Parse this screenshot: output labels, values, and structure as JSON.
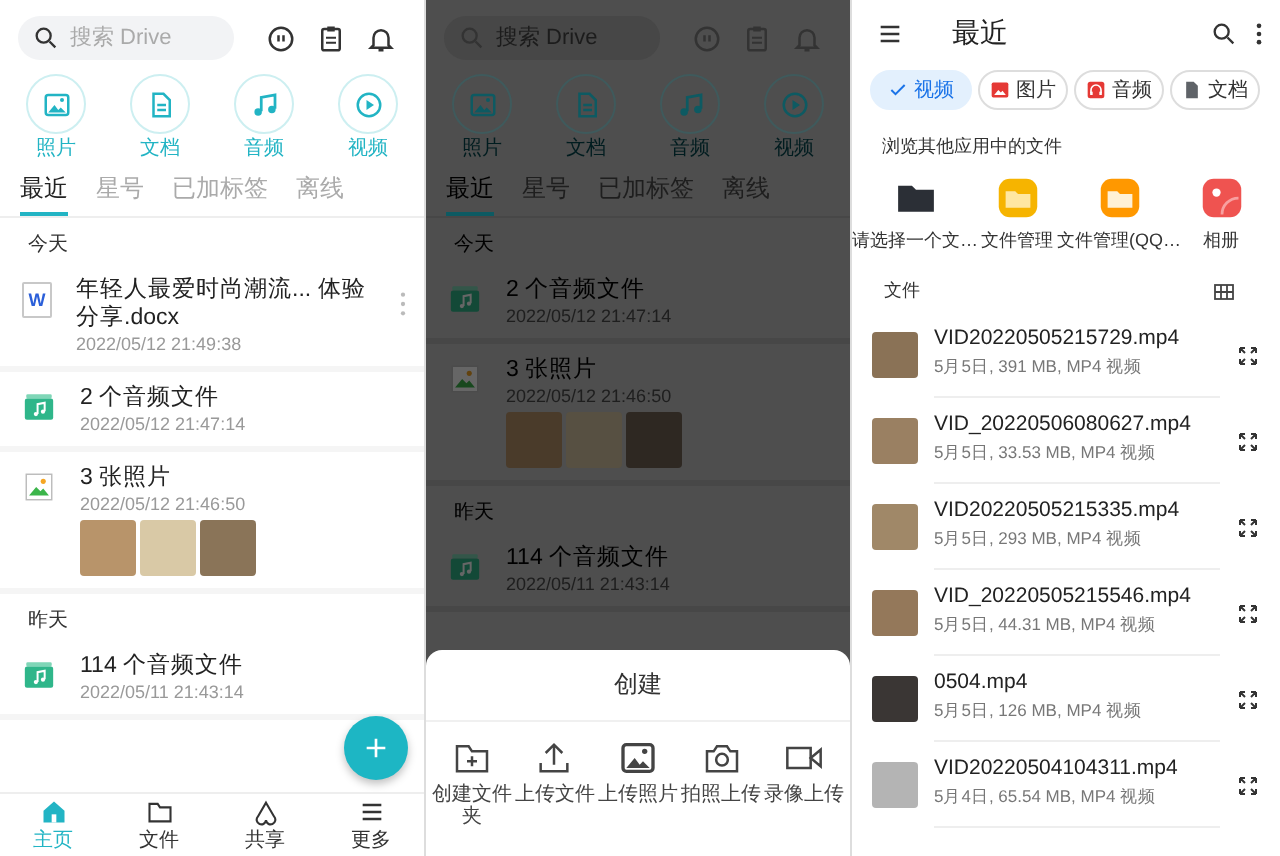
{
  "screens": [
    {
      "kind": "drive",
      "dimmed": false,
      "search": {
        "placeholder": "搜索 Drive"
      },
      "quick": [
        {
          "kind": "photo",
          "label": "照片"
        },
        {
          "kind": "doc",
          "label": "文档"
        },
        {
          "kind": "audio",
          "label": "音频"
        },
        {
          "kind": "video",
          "label": "视频"
        }
      ],
      "tabs": [
        {
          "label": "最近",
          "selected": true
        },
        {
          "label": "星号",
          "selected": false
        },
        {
          "label": "已加标签",
          "selected": false
        },
        {
          "label": "离线",
          "selected": false
        }
      ],
      "sections": [
        {
          "title": "今天",
          "items": [
            {
              "kind": "word",
              "icon_text": "W",
              "title": "年轻人最爱时尚潮流... 体验分享.docx",
              "time": "2022/05/12 21:49:38",
              "menu": true
            },
            {
              "kind": "audio",
              "title": "2 个音频文件",
              "time": "2022/05/12 21:47:14",
              "menu": false
            },
            {
              "kind": "photos",
              "title": "3 张照片",
              "time": "2022/05/12 21:46:50",
              "menu": false,
              "thumbnails": [
                {
                  "color": "#b8946a"
                },
                {
                  "color": "#d9c9a6"
                },
                {
                  "color": "#8a7458"
                }
              ]
            }
          ]
        },
        {
          "title": "昨天",
          "items": [
            {
              "kind": "audio",
              "title": "114 个音频文件",
              "time": "2022/05/11 21:43:14",
              "menu": false
            }
          ]
        }
      ],
      "fab": true,
      "nav": [
        {
          "kind": "home",
          "label": "主页",
          "selected": true
        },
        {
          "kind": "folder",
          "label": "文件",
          "selected": false
        },
        {
          "kind": "share",
          "label": "共享",
          "selected": false
        },
        {
          "kind": "more",
          "label": "更多",
          "selected": false
        }
      ]
    },
    {
      "kind": "drive",
      "dimmed": true,
      "search": {
        "placeholder": "搜索 Drive"
      },
      "quick": [
        {
          "kind": "photo",
          "label": "照片"
        },
        {
          "kind": "doc",
          "label": "文档"
        },
        {
          "kind": "audio",
          "label": "音频"
        },
        {
          "kind": "video",
          "label": "视频"
        }
      ],
      "tabs": [
        {
          "label": "最近",
          "selected": true
        },
        {
          "label": "星号",
          "selected": false
        },
        {
          "label": "已加标签",
          "selected": false
        },
        {
          "label": "离线",
          "selected": false
        }
      ],
      "sections": [
        {
          "title": "今天",
          "items": [
            {
              "kind": "audio",
              "title": "2 个音频文件",
              "time": "2022/05/12 21:47:14",
              "menu": false
            },
            {
              "kind": "photos",
              "title": "3 张照片",
              "time": "2022/05/12 21:46:50",
              "menu": false,
              "thumbnails": [
                {
                  "color": "#4a3b2a"
                },
                {
                  "color": "#575042"
                },
                {
                  "color": "#2e2822"
                }
              ]
            }
          ]
        },
        {
          "title": "昨天",
          "items": [
            {
              "kind": "audio",
              "title": "114 个音频文件",
              "time": "2022/05/11 21:43:14",
              "menu": false
            }
          ]
        }
      ],
      "fab": false,
      "sheet": {
        "title": "创建",
        "actions": [
          {
            "kind": "new-folder",
            "label": "创建文件夹"
          },
          {
            "kind": "upload",
            "label": "上传文件"
          },
          {
            "kind": "image",
            "label": "上传照片"
          },
          {
            "kind": "camera",
            "label": "拍照上传"
          },
          {
            "kind": "video",
            "label": "录像上传"
          }
        ]
      }
    },
    {
      "kind": "files",
      "title": "最近",
      "chips": [
        {
          "label": "视频",
          "selected": true
        },
        {
          "kind": "image",
          "label": "图片",
          "selected": false
        },
        {
          "kind": "audio",
          "label": "音频",
          "selected": false
        },
        {
          "kind": "doc",
          "label": "文档",
          "selected": false
        }
      ],
      "apps_heading": "浏览其他应用中的文件",
      "apps": [
        {
          "kind": "folder",
          "label": "请选择一个文…"
        },
        {
          "kind": "files",
          "label": "文件管理"
        },
        {
          "kind": "files-qq",
          "label": "文件管理(QQ…"
        },
        {
          "kind": "album",
          "label": "相册"
        }
      ],
      "files_heading": "文件",
      "files": [
        {
          "name": "VID20220505215729.mp4",
          "meta": "5月5日, 391 MB, MP4 视频",
          "color": "#8a7256"
        },
        {
          "name": "VID_20220506080627.mp4",
          "meta": "5月5日, 33.53 MB, MP4 视频",
          "color": "#9a8062"
        },
        {
          "name": "VID20220505215335.mp4",
          "meta": "5月5日, 293 MB, MP4 视频",
          "color": "#a08868"
        },
        {
          "name": "VID_20220505215546.mp4",
          "meta": "5月5日, 44.31 MB, MP4 视频",
          "color": "#94785a"
        },
        {
          "name": "0504.mp4",
          "meta": "5月5日, 126 MB, MP4 视频",
          "color": "#3a3634"
        },
        {
          "name": "VID20220504104311.mp4",
          "meta": "5月4日, 65.54 MB, MP4 视频",
          "color": "#b4b4b4"
        }
      ]
    }
  ]
}
